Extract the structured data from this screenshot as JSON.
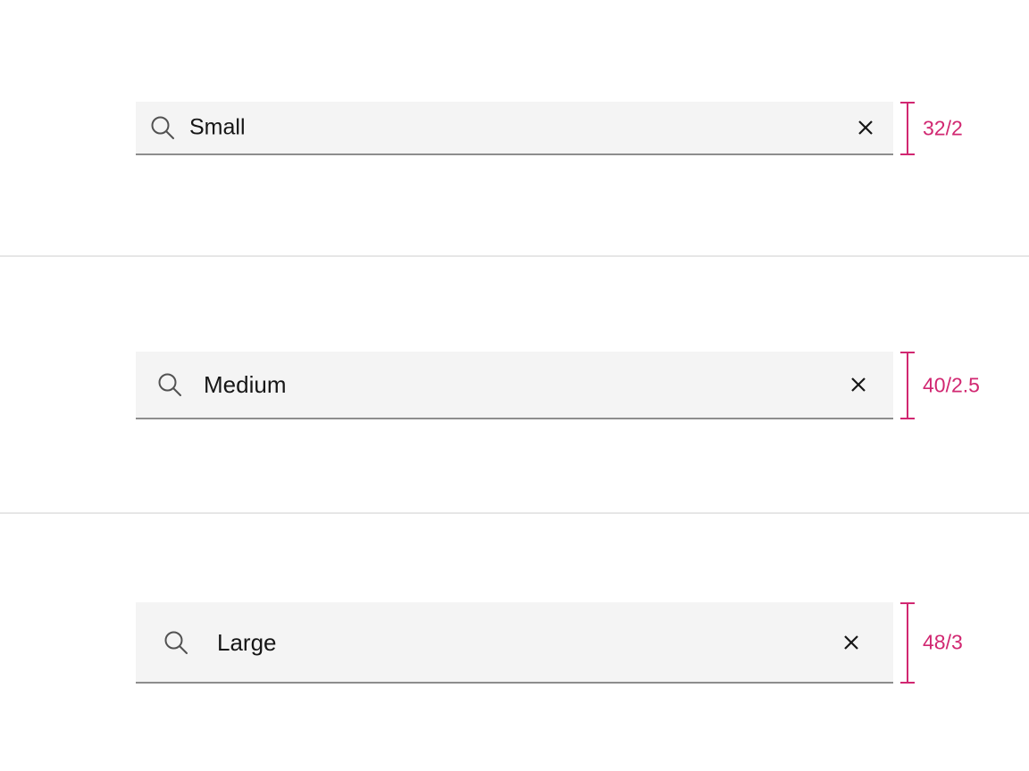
{
  "searches": {
    "small": {
      "value": "Small",
      "spec": "32/2"
    },
    "medium": {
      "value": "Medium",
      "spec": "40/2.5"
    },
    "large": {
      "value": "Large",
      "spec": "48/3"
    }
  },
  "icons": {
    "search": "search-icon",
    "clear": "close-icon"
  },
  "colors": {
    "field_bg": "#f4f4f4",
    "field_border": "#8d8d8d",
    "text": "#161616",
    "annotation": "#d12771",
    "divider": "#e6e6e6"
  }
}
